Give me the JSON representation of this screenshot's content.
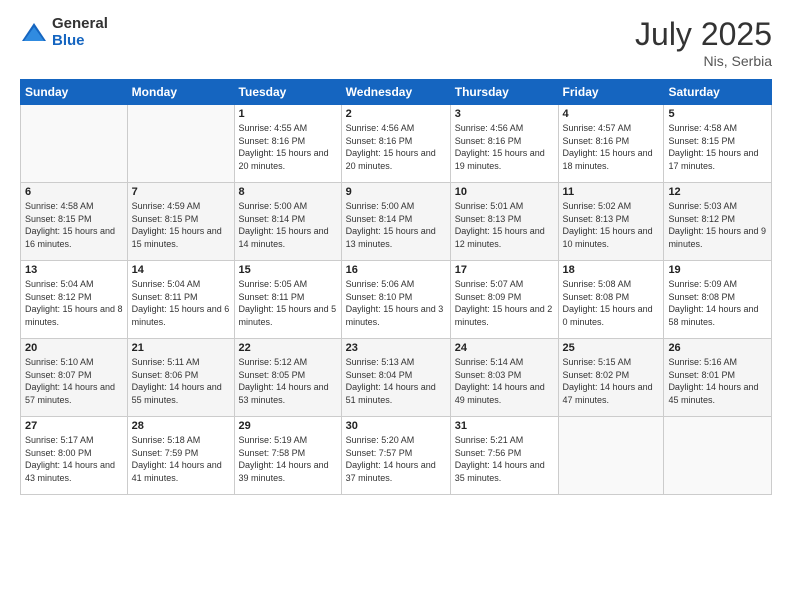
{
  "logo": {
    "general": "General",
    "blue": "Blue"
  },
  "header": {
    "month_year": "July 2025",
    "location": "Nis, Serbia"
  },
  "days_of_week": [
    "Sunday",
    "Monday",
    "Tuesday",
    "Wednesday",
    "Thursday",
    "Friday",
    "Saturday"
  ],
  "weeks": [
    [
      {
        "day": "",
        "empty": true
      },
      {
        "day": "",
        "empty": true
      },
      {
        "day": "1",
        "sunrise": "Sunrise: 4:55 AM",
        "sunset": "Sunset: 8:16 PM",
        "daylight": "Daylight: 15 hours and 20 minutes."
      },
      {
        "day": "2",
        "sunrise": "Sunrise: 4:56 AM",
        "sunset": "Sunset: 8:16 PM",
        "daylight": "Daylight: 15 hours and 20 minutes."
      },
      {
        "day": "3",
        "sunrise": "Sunrise: 4:56 AM",
        "sunset": "Sunset: 8:16 PM",
        "daylight": "Daylight: 15 hours and 19 minutes."
      },
      {
        "day": "4",
        "sunrise": "Sunrise: 4:57 AM",
        "sunset": "Sunset: 8:16 PM",
        "daylight": "Daylight: 15 hours and 18 minutes."
      },
      {
        "day": "5",
        "sunrise": "Sunrise: 4:58 AM",
        "sunset": "Sunset: 8:15 PM",
        "daylight": "Daylight: 15 hours and 17 minutes."
      }
    ],
    [
      {
        "day": "6",
        "sunrise": "Sunrise: 4:58 AM",
        "sunset": "Sunset: 8:15 PM",
        "daylight": "Daylight: 15 hours and 16 minutes."
      },
      {
        "day": "7",
        "sunrise": "Sunrise: 4:59 AM",
        "sunset": "Sunset: 8:15 PM",
        "daylight": "Daylight: 15 hours and 15 minutes."
      },
      {
        "day": "8",
        "sunrise": "Sunrise: 5:00 AM",
        "sunset": "Sunset: 8:14 PM",
        "daylight": "Daylight: 15 hours and 14 minutes."
      },
      {
        "day": "9",
        "sunrise": "Sunrise: 5:00 AM",
        "sunset": "Sunset: 8:14 PM",
        "daylight": "Daylight: 15 hours and 13 minutes."
      },
      {
        "day": "10",
        "sunrise": "Sunrise: 5:01 AM",
        "sunset": "Sunset: 8:13 PM",
        "daylight": "Daylight: 15 hours and 12 minutes."
      },
      {
        "day": "11",
        "sunrise": "Sunrise: 5:02 AM",
        "sunset": "Sunset: 8:13 PM",
        "daylight": "Daylight: 15 hours and 10 minutes."
      },
      {
        "day": "12",
        "sunrise": "Sunrise: 5:03 AM",
        "sunset": "Sunset: 8:12 PM",
        "daylight": "Daylight: 15 hours and 9 minutes."
      }
    ],
    [
      {
        "day": "13",
        "sunrise": "Sunrise: 5:04 AM",
        "sunset": "Sunset: 8:12 PM",
        "daylight": "Daylight: 15 hours and 8 minutes."
      },
      {
        "day": "14",
        "sunrise": "Sunrise: 5:04 AM",
        "sunset": "Sunset: 8:11 PM",
        "daylight": "Daylight: 15 hours and 6 minutes."
      },
      {
        "day": "15",
        "sunrise": "Sunrise: 5:05 AM",
        "sunset": "Sunset: 8:11 PM",
        "daylight": "Daylight: 15 hours and 5 minutes."
      },
      {
        "day": "16",
        "sunrise": "Sunrise: 5:06 AM",
        "sunset": "Sunset: 8:10 PM",
        "daylight": "Daylight: 15 hours and 3 minutes."
      },
      {
        "day": "17",
        "sunrise": "Sunrise: 5:07 AM",
        "sunset": "Sunset: 8:09 PM",
        "daylight": "Daylight: 15 hours and 2 minutes."
      },
      {
        "day": "18",
        "sunrise": "Sunrise: 5:08 AM",
        "sunset": "Sunset: 8:08 PM",
        "daylight": "Daylight: 15 hours and 0 minutes."
      },
      {
        "day": "19",
        "sunrise": "Sunrise: 5:09 AM",
        "sunset": "Sunset: 8:08 PM",
        "daylight": "Daylight: 14 hours and 58 minutes."
      }
    ],
    [
      {
        "day": "20",
        "sunrise": "Sunrise: 5:10 AM",
        "sunset": "Sunset: 8:07 PM",
        "daylight": "Daylight: 14 hours and 57 minutes."
      },
      {
        "day": "21",
        "sunrise": "Sunrise: 5:11 AM",
        "sunset": "Sunset: 8:06 PM",
        "daylight": "Daylight: 14 hours and 55 minutes."
      },
      {
        "day": "22",
        "sunrise": "Sunrise: 5:12 AM",
        "sunset": "Sunset: 8:05 PM",
        "daylight": "Daylight: 14 hours and 53 minutes."
      },
      {
        "day": "23",
        "sunrise": "Sunrise: 5:13 AM",
        "sunset": "Sunset: 8:04 PM",
        "daylight": "Daylight: 14 hours and 51 minutes."
      },
      {
        "day": "24",
        "sunrise": "Sunrise: 5:14 AM",
        "sunset": "Sunset: 8:03 PM",
        "daylight": "Daylight: 14 hours and 49 minutes."
      },
      {
        "day": "25",
        "sunrise": "Sunrise: 5:15 AM",
        "sunset": "Sunset: 8:02 PM",
        "daylight": "Daylight: 14 hours and 47 minutes."
      },
      {
        "day": "26",
        "sunrise": "Sunrise: 5:16 AM",
        "sunset": "Sunset: 8:01 PM",
        "daylight": "Daylight: 14 hours and 45 minutes."
      }
    ],
    [
      {
        "day": "27",
        "sunrise": "Sunrise: 5:17 AM",
        "sunset": "Sunset: 8:00 PM",
        "daylight": "Daylight: 14 hours and 43 minutes."
      },
      {
        "day": "28",
        "sunrise": "Sunrise: 5:18 AM",
        "sunset": "Sunset: 7:59 PM",
        "daylight": "Daylight: 14 hours and 41 minutes."
      },
      {
        "day": "29",
        "sunrise": "Sunrise: 5:19 AM",
        "sunset": "Sunset: 7:58 PM",
        "daylight": "Daylight: 14 hours and 39 minutes."
      },
      {
        "day": "30",
        "sunrise": "Sunrise: 5:20 AM",
        "sunset": "Sunset: 7:57 PM",
        "daylight": "Daylight: 14 hours and 37 minutes."
      },
      {
        "day": "31",
        "sunrise": "Sunrise: 5:21 AM",
        "sunset": "Sunset: 7:56 PM",
        "daylight": "Daylight: 14 hours and 35 minutes."
      },
      {
        "day": "",
        "empty": true
      },
      {
        "day": "",
        "empty": true
      }
    ]
  ]
}
